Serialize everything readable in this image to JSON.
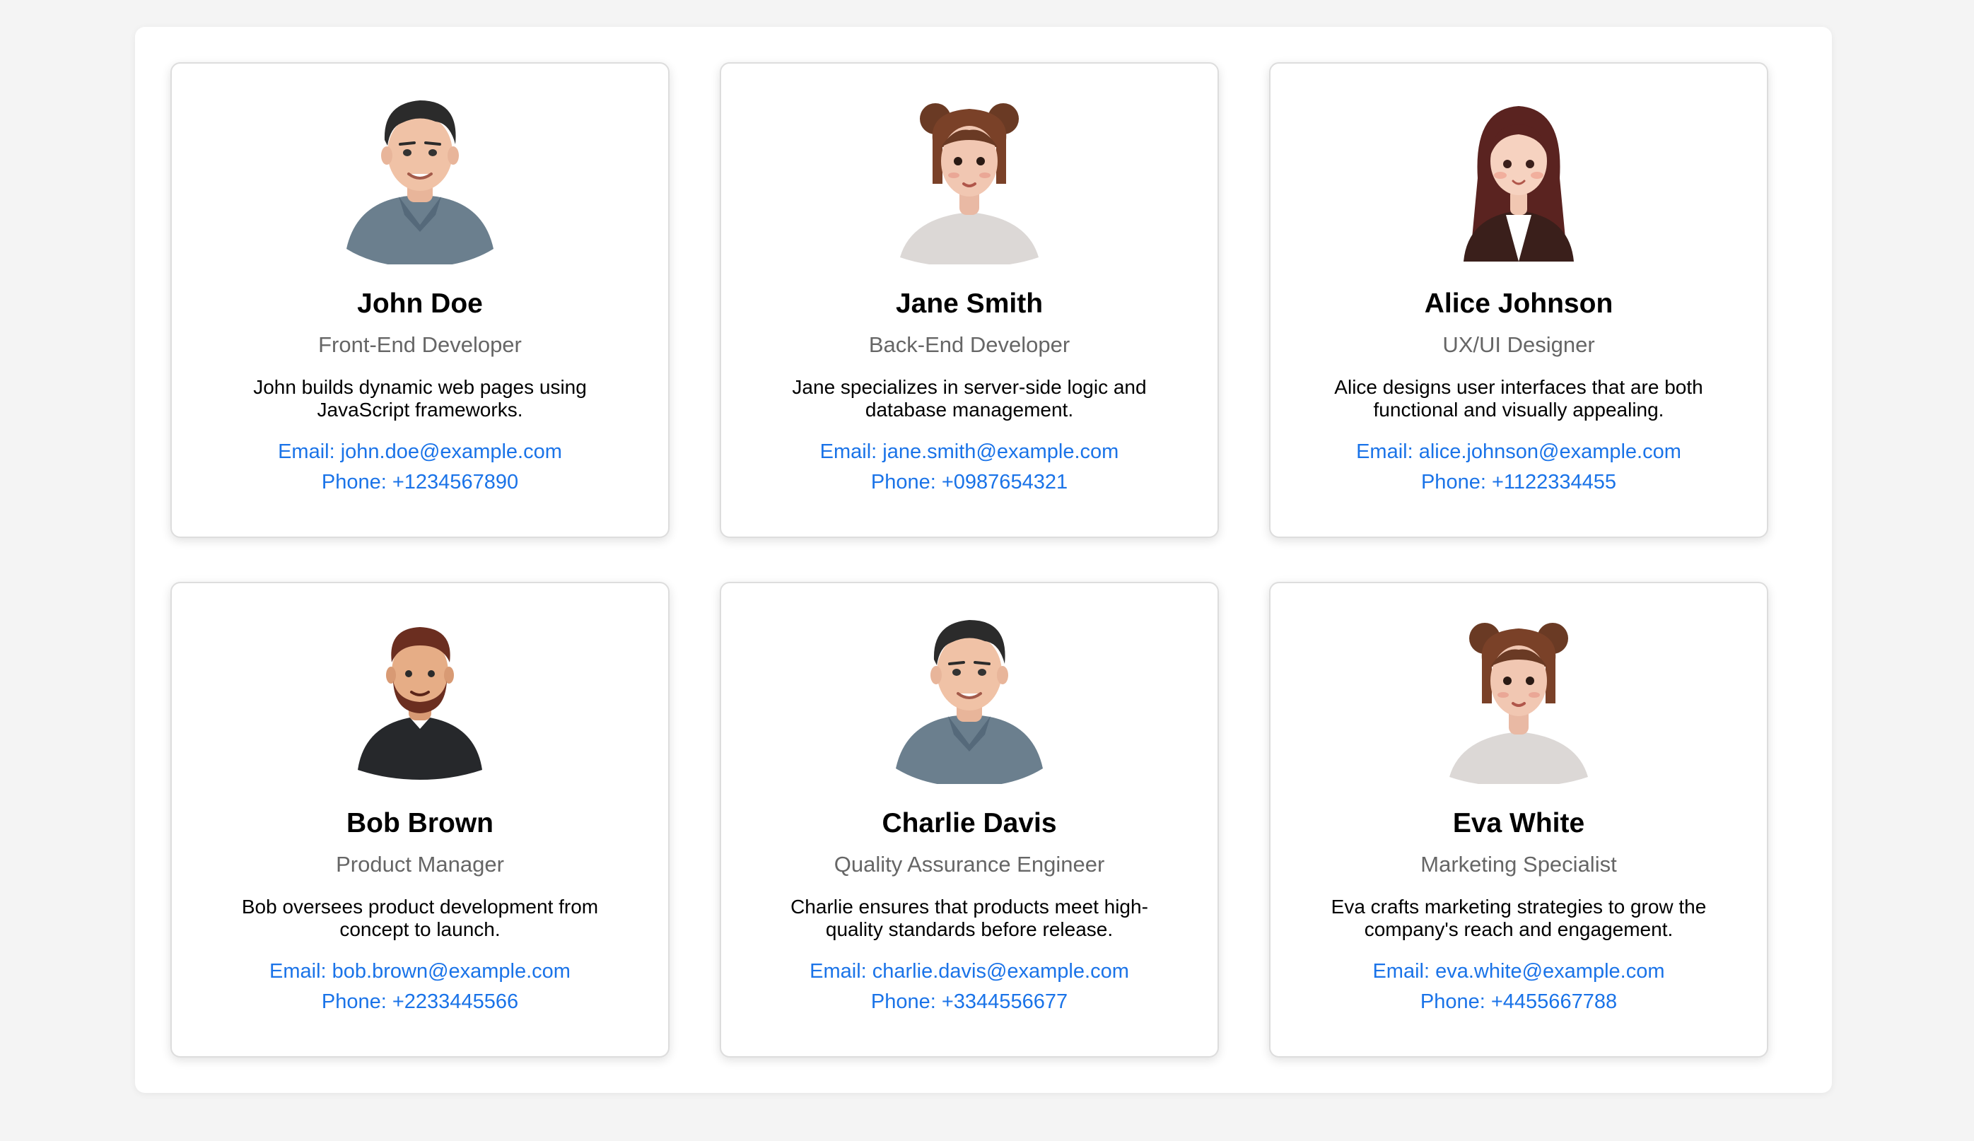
{
  "team": [
    {
      "name": "John Doe",
      "role": "Front-End Developer",
      "description": "John builds dynamic web pages using JavaScript frameworks.",
      "email": "Email: john.doe@example.com",
      "phone": "Phone: +1234567890",
      "avatar_icon": "man-dark-hair-gray-shirt-avatar"
    },
    {
      "name": "Jane Smith",
      "role": "Back-End Developer",
      "description": "Jane specializes in server-side logic and database management.",
      "email": "Email: jane.smith@example.com",
      "phone": "Phone: +0987654321",
      "avatar_icon": "woman-hair-buns-avatar"
    },
    {
      "name": "Alice Johnson",
      "role": "UX/UI Designer",
      "description": "Alice designs user interfaces that are both functional and visually appealing.",
      "email": "Email: alice.johnson@example.com",
      "phone": "Phone: +1122334455",
      "avatar_icon": "woman-long-hair-blazer-avatar"
    },
    {
      "name": "Bob Brown",
      "role": "Product Manager",
      "description": "Bob oversees product development from concept to launch.",
      "email": "Email: bob.brown@example.com",
      "phone": "Phone: +2233445566",
      "avatar_icon": "man-beard-dark-jacket-avatar"
    },
    {
      "name": "Charlie Davis",
      "role": "Quality Assurance Engineer",
      "description": "Charlie ensures that products meet high-quality standards before release.",
      "email": "Email: charlie.davis@example.com",
      "phone": "Phone: +3344556677",
      "avatar_icon": "man-dark-hair-gray-shirt-avatar"
    },
    {
      "name": "Eva White",
      "role": "Marketing Specialist",
      "description": "Eva crafts marketing strategies to grow the company's reach and engagement.",
      "email": "Email: eva.white@example.com",
      "phone": "Phone: +4455667788",
      "avatar_icon": "woman-hair-buns-avatar"
    }
  ],
  "colors": {
    "page_background": "#f4f4f4",
    "container_background": "#ffffff",
    "link": "#1a73e8",
    "role_text": "#666666"
  }
}
